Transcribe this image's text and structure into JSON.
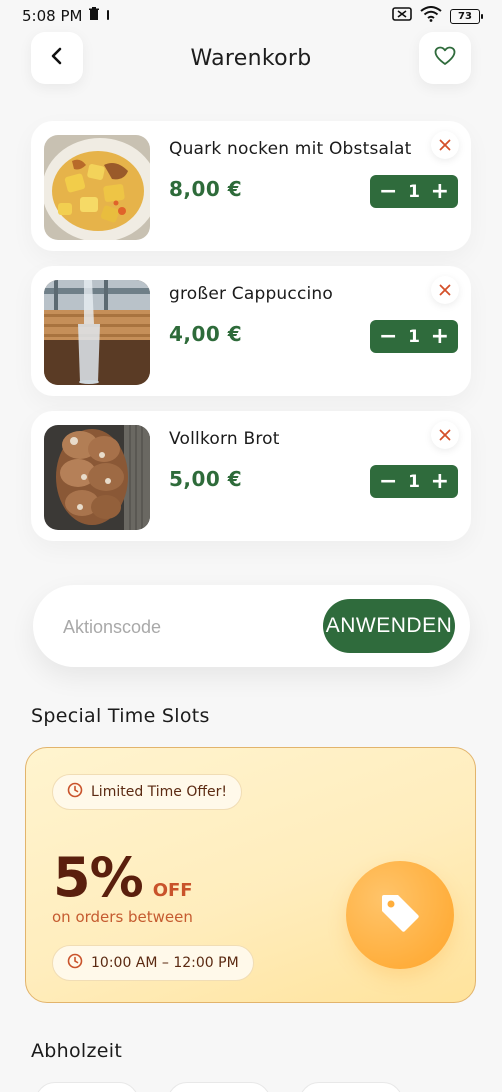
{
  "status_bar": {
    "time": "5:08 PM",
    "battery": "73"
  },
  "header": {
    "title": "Warenkorb"
  },
  "cart": {
    "items": [
      {
        "name": "Quark nocken mit Obstsalat",
        "price": "8,00 €",
        "quantity": "1"
      },
      {
        "name": "großer Cappuccino",
        "price": "4,00 €",
        "quantity": "1"
      },
      {
        "name": "Vollkorn Brot",
        "price": "5,00 €",
        "quantity": "1"
      }
    ],
    "minus_symbol": "−",
    "plus_symbol": "+"
  },
  "promo": {
    "placeholder": "Aktionscode",
    "apply_label": "ANWENDEN"
  },
  "special": {
    "section_title": "Special Time Slots",
    "badge": "Limited Time Offer!",
    "percent": "5%",
    "off_label": "OFF",
    "subtitle": "on orders between",
    "time_range": "10:00 AM – 12:00 PM"
  },
  "pickup": {
    "section_title": "Abholzeit"
  },
  "colors": {
    "primary_green": "#2f6b3c",
    "remove_red": "#d4502a",
    "offer_brown": "#5a1f0d",
    "offer_orange": "#ffae3c"
  },
  "icons": {
    "back": "chevron-left-icon",
    "favorite": "heart-outline-icon",
    "remove": "close-icon",
    "clock": "clock-icon",
    "tag": "price-tag-icon"
  }
}
